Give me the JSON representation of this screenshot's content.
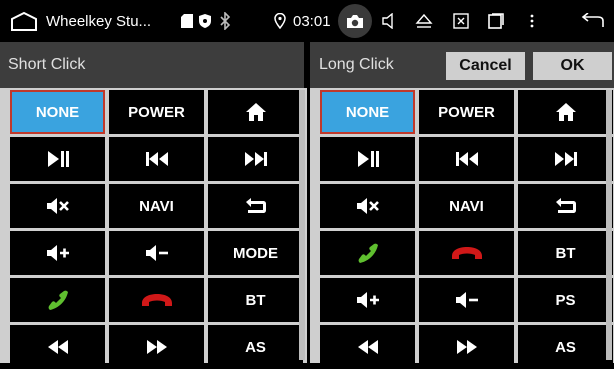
{
  "status_bar": {
    "app_title": "Wheelkey Stu...",
    "time": "03:01",
    "icons": [
      "home-outline-icon",
      "sd-card-icon",
      "shield-icon",
      "bluetooth-icon",
      "location-icon",
      "camera-icon",
      "volume-icon",
      "eject-icon",
      "close-box-icon",
      "recent-apps-icon",
      "more-vert-icon",
      "back-icon"
    ]
  },
  "headers": {
    "short_click": "Short Click",
    "long_click": "Long Click",
    "cancel_label": "Cancel",
    "ok_label": "OK"
  },
  "short_click_keys": [
    {
      "label": "NONE",
      "icon": "",
      "selected": true
    },
    {
      "label": "POWER",
      "icon": "",
      "selected": false
    },
    {
      "label": "",
      "icon": "home-icon",
      "selected": false
    },
    {
      "label": "",
      "icon": "play-pause-icon",
      "selected": false
    },
    {
      "label": "",
      "icon": "previous-track-icon",
      "selected": false
    },
    {
      "label": "",
      "icon": "next-track-icon",
      "selected": false
    },
    {
      "label": "",
      "icon": "mute-icon",
      "selected": false
    },
    {
      "label": "NAVI",
      "icon": "",
      "selected": false
    },
    {
      "label": "",
      "icon": "return-icon",
      "selected": false
    },
    {
      "label": "",
      "icon": "volume-up-icon",
      "selected": false
    },
    {
      "label": "",
      "icon": "volume-down-icon",
      "selected": false
    },
    {
      "label": "MODE",
      "icon": "",
      "selected": false
    },
    {
      "label": "",
      "icon": "call-accept-icon",
      "selected": false
    },
    {
      "label": "",
      "icon": "call-end-icon",
      "selected": false
    },
    {
      "label": "BT",
      "icon": "",
      "selected": false
    },
    {
      "label": "",
      "icon": "rewind-icon",
      "selected": false
    },
    {
      "label": "",
      "icon": "fast-forward-icon",
      "selected": false
    },
    {
      "label": "AS",
      "icon": "",
      "selected": false
    }
  ],
  "long_click_keys": [
    {
      "label": "NONE",
      "icon": "",
      "selected": true
    },
    {
      "label": "POWER",
      "icon": "",
      "selected": false
    },
    {
      "label": "",
      "icon": "home-icon",
      "selected": false
    },
    {
      "label": "",
      "icon": "play-pause-icon",
      "selected": false
    },
    {
      "label": "",
      "icon": "previous-track-icon",
      "selected": false
    },
    {
      "label": "",
      "icon": "next-track-icon",
      "selected": false
    },
    {
      "label": "",
      "icon": "mute-icon",
      "selected": false
    },
    {
      "label": "NAVI",
      "icon": "",
      "selected": false
    },
    {
      "label": "",
      "icon": "return-icon",
      "selected": false
    },
    {
      "label": "",
      "icon": "call-accept-icon",
      "selected": false
    },
    {
      "label": "",
      "icon": "call-end-icon",
      "selected": false
    },
    {
      "label": "BT",
      "icon": "",
      "selected": false
    },
    {
      "label": "",
      "icon": "volume-up-icon",
      "selected": false
    },
    {
      "label": "",
      "icon": "volume-down-icon",
      "selected": false
    },
    {
      "label": "PS",
      "icon": "",
      "selected": false
    },
    {
      "label": "",
      "icon": "rewind-icon",
      "selected": false
    },
    {
      "label": "",
      "icon": "fast-forward-icon",
      "selected": false
    },
    {
      "label": "AS",
      "icon": "",
      "selected": false
    }
  ],
  "colors": {
    "selected_bg": "#3aa3df",
    "selected_border": "#c0392b",
    "key_bg": "#000000",
    "panel_bg": "#cfcfcf",
    "header_bg": "#3d3d3d",
    "call_accept": "#5fbf2f",
    "call_end": "#d01818"
  }
}
